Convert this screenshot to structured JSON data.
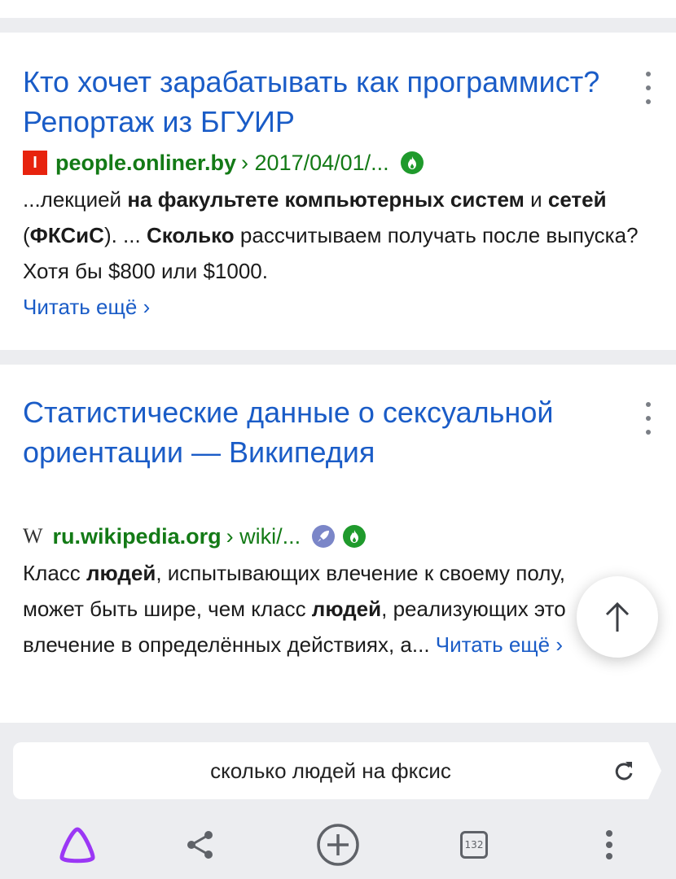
{
  "results": [
    {
      "title": "Кто хочет зарабатывать как программист? Репортаж из БГУИР",
      "favicon_letter": "I",
      "domain": "people.onliner.by",
      "path": "› 2017/04/01/...",
      "snippet": [
        {
          "t": "...лекцией "
        },
        {
          "t": "на факультете компьютерных систем",
          "b": true
        },
        {
          "t": " и "
        },
        {
          "t": "сетей",
          "b": true
        },
        {
          "t": " ("
        },
        {
          "t": "ФКСиС",
          "b": true
        },
        {
          "t": "). ... "
        },
        {
          "t": "Сколько",
          "b": true
        },
        {
          "t": " рассчитываем получать после выпуска? Хотя бы $800 или $1000."
        }
      ],
      "read_more": "Читать ещё ›"
    },
    {
      "title": "Статистические данные о сексуальной ориентации — Википедия",
      "favicon_letter": "W",
      "domain": "ru.wikipedia.org",
      "path": "› wiki/...",
      "snippet": [
        {
          "t": "Класс "
        },
        {
          "t": "людей",
          "b": true
        },
        {
          "t": ", испытывающих влечение к своему полу, может быть шире, чем класс "
        },
        {
          "t": "людей",
          "b": true
        },
        {
          "t": ", реализующих это влечение в определённых действиях, а... "
        }
      ],
      "read_more": "Читать ещё ›"
    }
  ],
  "search": {
    "query": "сколько людей на фксис"
  },
  "toolbar": {
    "tabs_count": "132",
    "icons": [
      "alice-icon",
      "share-icon",
      "new-tab-icon",
      "tabs-icon",
      "more-icon"
    ]
  },
  "colors": {
    "link": "#1a5cc7",
    "domain": "#137a16",
    "alice": "#9b37f5",
    "background": "#ecedf0"
  }
}
